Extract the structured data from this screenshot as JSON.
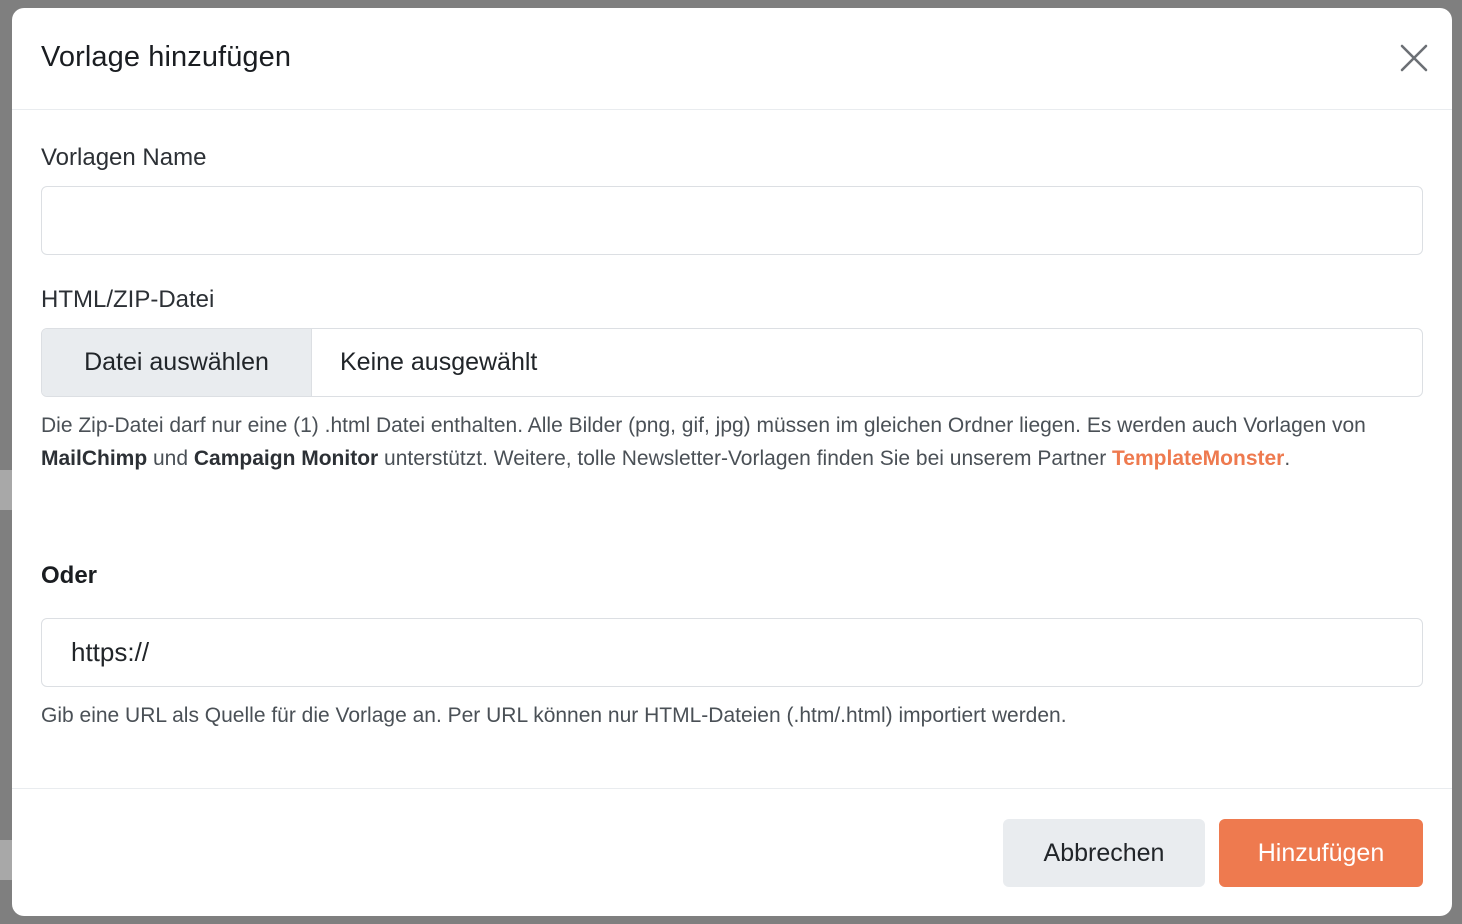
{
  "dialog": {
    "title": "Vorlage hinzufügen",
    "close_icon": "close-icon"
  },
  "form": {
    "name_label": "Vorlagen Name",
    "name_value": "",
    "file_label": "HTML/ZIP-Datei",
    "file_button": "Datei auswählen",
    "file_status": "Keine ausgewählt",
    "file_help": {
      "part1": "Die Zip-Datei darf nur eine (1) .html Datei enthalten. Alle Bilder (png, gif, jpg) müssen im gleichen Ordner liegen. Es werden auch Vorlagen von ",
      "mailchimp": "MailChimp",
      "part2": " und ",
      "campaign_monitor": "Campaign Monitor",
      "part3": " unterstützt. Weitere, tolle Newsletter-Vorlagen finden Sie bei unserem Partner ",
      "partner": "TemplateMonster",
      "part4": "."
    },
    "or_label": "Oder",
    "url_value": "https://",
    "url_help": "Gib eine URL als Quelle für die Vorlage an. Per URL können nur HTML-Dateien (.htm/.html) importiert werden."
  },
  "footer": {
    "cancel_label": "Abbrechen",
    "submit_label": "Hinzufügen"
  },
  "colors": {
    "accent": "#ee7a4f",
    "secondary_button": "#e9ecef",
    "overlay": "#7f7f7f"
  }
}
